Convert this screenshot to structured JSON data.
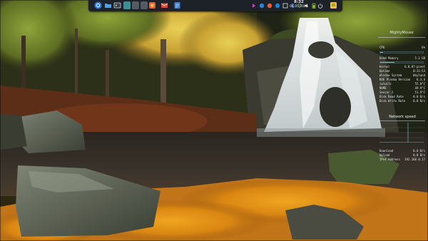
{
  "panel": {
    "icons": [
      {
        "name": "system-menu-icon",
        "color": "#2b82d9"
      },
      {
        "name": "file-manager-icon",
        "color": "#4aa3e8"
      },
      {
        "name": "terminal-icon",
        "color": "#cfd6dc"
      },
      {
        "name": "workspace-1",
        "color": "#3d8f95"
      },
      {
        "name": "workspace-2",
        "color": "#555b62"
      },
      {
        "name": "workspace-3",
        "color": "#555b62"
      },
      {
        "name": "browser-icon",
        "color": "#e85d3a"
      },
      {
        "name": "mail-icon",
        "color": "#d9463a"
      },
      {
        "name": "text-editor-icon",
        "color": "#3f80d6"
      }
    ],
    "tray_icons": [
      {
        "name": "tray-app-1-icon",
        "color": "#c040c0"
      },
      {
        "name": "tray-app-2-icon",
        "color": "#2b82d9"
      },
      {
        "name": "tray-app-3-icon",
        "color": "#e85d3a"
      },
      {
        "name": "tray-app-4-icon",
        "color": "#1b7fd6"
      },
      {
        "name": "tray-app-5-icon",
        "color": "#e0e0e0"
      },
      {
        "name": "bluetooth-icon",
        "color": "#3b82f6"
      },
      {
        "name": "network-icon",
        "color": "#4caf50"
      },
      {
        "name": "volume-icon",
        "color": "#e8e8e8"
      },
      {
        "name": "battery-icon",
        "color": "#9acd32"
      },
      {
        "name": "power-icon",
        "color": "#e8e8e8"
      }
    ],
    "clock_time": "8:32",
    "clock_date": "01.05.2025",
    "notes_icon_color": "#e6c53a"
  },
  "conky": {
    "hostname": "MightyMouse",
    "cpu_label": "CPU",
    "cpu_value": "6%",
    "cpu_level": 0.06,
    "memory_label": "Used Memory",
    "memory_value": "5.1 GB",
    "memory_level": 0.33,
    "info": [
      {
        "k": "Kernel",
        "v": "6.8.87-pinet"
      },
      {
        "k": "Uptime",
        "v": "0:21:53"
      },
      {
        "k": "Window System",
        "v": "Wayland"
      },
      {
        "k": "KDE Plasma Version",
        "v": "6.3.4"
      },
      {
        "k": "iwlwifi",
        "v": "55.0°C"
      },
      {
        "k": "NVME",
        "v": "49.9°C"
      },
      {
        "k": "Sensor 2",
        "v": "51.9°C"
      },
      {
        "k": "Disk Read Rate",
        "v": "0.0 B/s"
      },
      {
        "k": "Disk Write Rate",
        "v": "0.0 B/s"
      }
    ],
    "network_title": "Network speed",
    "net_stats": [
      {
        "k": "Download",
        "v": "0.0 B/s"
      },
      {
        "k": "Upload",
        "v": "0.0 B/s"
      },
      {
        "k": "IPv4 Address",
        "v": "192.168.0.17"
      }
    ]
  }
}
